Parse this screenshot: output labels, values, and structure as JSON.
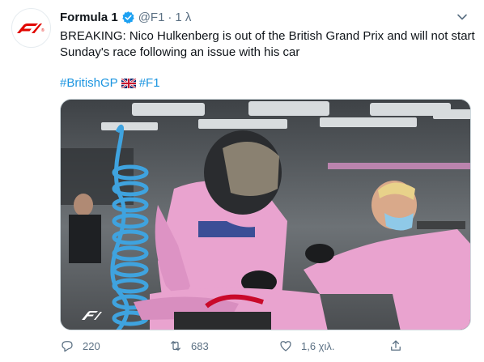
{
  "tweet": {
    "author_name": "Formula 1",
    "handle": "@F1",
    "separator": "·",
    "time": "1 λ",
    "text_line1": "BREAKING: Nico Hulkenberg is out of the British Grand Prix and will not start",
    "text_line2": "Sunday's race following an issue with his car",
    "hashtag1": "#BritishGP",
    "hashtag2": "#F1",
    "avatar_logo": "F1",
    "media_watermark": "F1"
  },
  "actions": {
    "replies": "220",
    "retweets": "683",
    "likes": "1,6 χιλ."
  },
  "colors": {
    "link": "#1b95e0",
    "secondary": "#5b7083",
    "brand_red": "#e10600",
    "verified": "#1da1f2",
    "kit_pink": "#e9a3cf"
  },
  "icons": [
    "f1-logo-icon",
    "verified-badge-icon",
    "chevron-down-icon",
    "uk-flag-icon",
    "reply-icon",
    "retweet-icon",
    "like-icon",
    "share-icon"
  ]
}
